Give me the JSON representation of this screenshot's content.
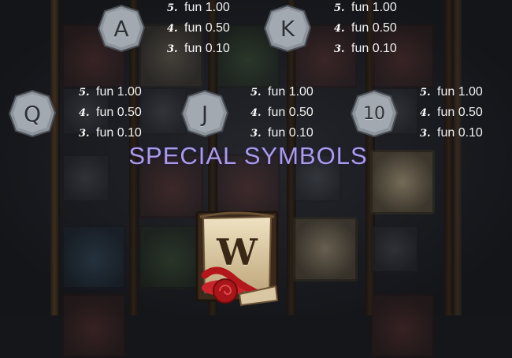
{
  "paytable": [
    {
      "symbol": "A",
      "rows": [
        {
          "count": "5.",
          "value": "fun 1.00"
        },
        {
          "count": "4.",
          "value": "fun 0.50"
        },
        {
          "count": "3.",
          "value": "fun 0.10"
        }
      ]
    },
    {
      "symbol": "K",
      "rows": [
        {
          "count": "5.",
          "value": "fun 1.00"
        },
        {
          "count": "4.",
          "value": "fun 0.50"
        },
        {
          "count": "3.",
          "value": "fun 0.10"
        }
      ]
    },
    {
      "symbol": "Q",
      "rows": [
        {
          "count": "5.",
          "value": "fun 1.00"
        },
        {
          "count": "4.",
          "value": "fun 0.50"
        },
        {
          "count": "3.",
          "value": "fun 0.10"
        }
      ]
    },
    {
      "symbol": "J",
      "rows": [
        {
          "count": "5.",
          "value": "fun 1.00"
        },
        {
          "count": "4.",
          "value": "fun 0.50"
        },
        {
          "count": "3.",
          "value": "fun 0.10"
        }
      ]
    },
    {
      "symbol": "10",
      "rows": [
        {
          "count": "5.",
          "value": "fun 1.00"
        },
        {
          "count": "4.",
          "value": "fun 0.50"
        },
        {
          "count": "3.",
          "value": "fun 0.10"
        }
      ]
    }
  ],
  "special": {
    "title": "SPECIAL SYMBOLS",
    "wild_symbol": "W"
  },
  "colors": {
    "title": "#a99ce8",
    "stone": "#8d939b",
    "scroll": "#d8c7a2",
    "seal": "#b3171b"
  }
}
